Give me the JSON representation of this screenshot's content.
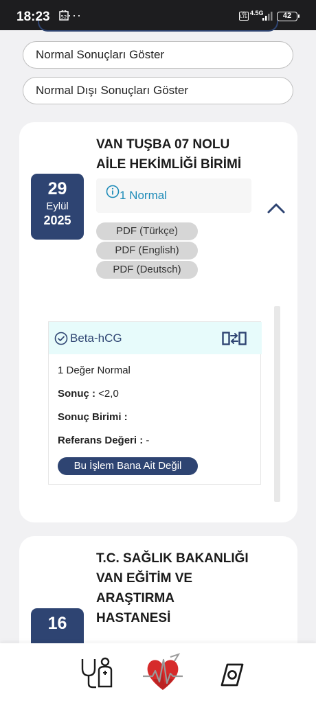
{
  "status_bar": {
    "time": "18:23",
    "notification_badge": "52",
    "dots": "···",
    "network": "4.5G",
    "volte": "Vo LTE",
    "battery": "42"
  },
  "filters": {
    "normal_label": "Normal Sonuçları Göster",
    "abnormal_label": "Normal Dışı Sonuçları Göster"
  },
  "results": [
    {
      "hospital_line1": "VAN TUŞBA 07 NOLU",
      "hospital_line2": "AİLE HEKİMLİĞİ BİRİMİ",
      "date_day": "29",
      "date_month": "Eylül",
      "date_year": "2025",
      "status_text": "1 Normal",
      "pdf_tr": "PDF (Türkçe)",
      "pdf_en": "PDF (English)",
      "pdf_de": "PDF (Deutsch)",
      "test": {
        "name": "Beta-hCG",
        "normal_count": "1 Değer Normal",
        "result_label": "Sonuç :",
        "result_value": "<2,0",
        "unit_label": "Sonuç Birimi :",
        "unit_value": "",
        "reference_label": "Referans Değeri :",
        "reference_value": "-",
        "not_mine_button": "Bu İşlem Bana Ait Değil"
      }
    },
    {
      "hospital_line1": "T.C. SAĞLIK BAKANLIĞI",
      "hospital_line2": "VAN EĞİTİM VE",
      "hospital_line3": "ARAŞTIRMA",
      "hospital_line4": "HASTANESİ",
      "date_day": "16"
    }
  ],
  "colors": {
    "primary": "#2e4472",
    "accent_red": "#d62b2b",
    "info_blue": "#1d8bb8",
    "test_header_bg": "#e7fbfb"
  },
  "bottom_nav": {
    "icons": [
      "doctor-patient-icon",
      "heart-logo-icon",
      "capsule-pill-icon"
    ]
  }
}
